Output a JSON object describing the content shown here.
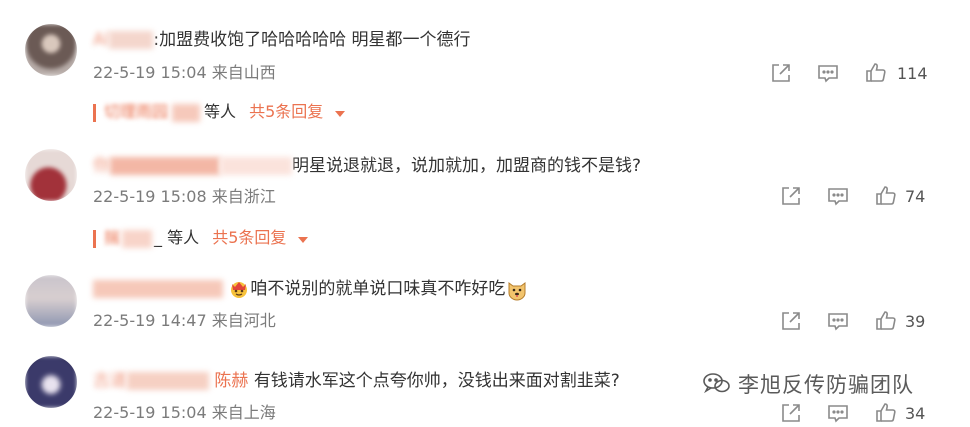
{
  "comments": [
    {
      "user": "Al",
      "text": ":加盟费收饱了哈哈哈哈哈 明星都一个德行",
      "meta": "22-5-19 15:04 来自山西",
      "likes": "114",
      "replies": {
        "who": "切理雨园",
        "suffix": "等人",
        "total": "共5条回复"
      }
    },
    {
      "user": "你",
      "text": "明星说退就退，说加就加，加盟商的钱不是钱?",
      "meta": "22-5-19 15:08 来自浙江",
      "likes": "74",
      "replies": {
        "who": "揣",
        "suffix": "_ 等人",
        "total": "共5条回复"
      }
    },
    {
      "user": "",
      "text": "咱不说别的就单说口味真不咋好吃",
      "meta": "22-5-19 14:47 来自河北",
      "likes": "39",
      "emoji_before": "crown-face-emoji",
      "emoji_after": "dog-face-emoji"
    },
    {
      "user": "古道",
      "mention": "陈赫",
      "text": "有钱请水军这个点夸你帅，没钱出来面对割韭菜?",
      "meta": "22-5-19 15:04 来自上海",
      "likes": "34"
    }
  ],
  "watermark": {
    "text": "李旭反传防骗团队",
    "icon": "wechat-official-icon"
  },
  "colors": {
    "accent": "#eb7350",
    "meta": "#7b7b7b",
    "icon": "#8a8a8a"
  }
}
